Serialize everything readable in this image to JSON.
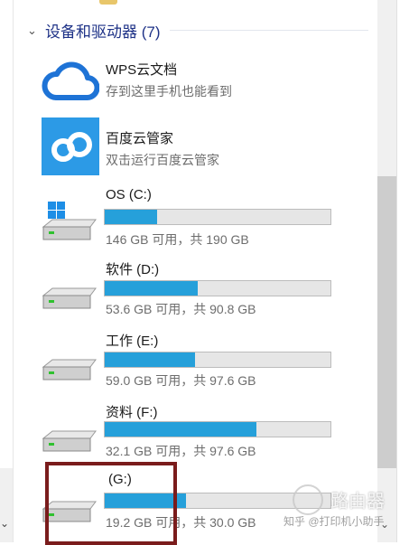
{
  "group": {
    "title": "设备和驱动器 (7)"
  },
  "items": [
    {
      "name": "WPS云文档",
      "sub": "存到这里手机也能看到",
      "icon": "wps-cloud-icon"
    },
    {
      "name": "百度云管家",
      "sub": "双击运行百度云管家",
      "icon": "baidu-cloud-icon"
    }
  ],
  "drives": [
    {
      "name": "OS (C:)",
      "usage": "146 GB 可用，共 190 GB",
      "used_fraction": 0.23
    },
    {
      "name": "软件 (D:)",
      "usage": "53.6 GB 可用，共 90.8 GB",
      "used_fraction": 0.41
    },
    {
      "name": "工作 (E:)",
      "usage": "59.0 GB 可用，共 97.6 GB",
      "used_fraction": 0.4
    },
    {
      "name": "资料 (F:)",
      "usage": "32.1 GB 可用，共 97.6 GB",
      "used_fraction": 0.67
    },
    {
      "name": "(G:)",
      "usage": "19.2 GB 可用，共 30.0 GB",
      "used_fraction": 0.36
    }
  ],
  "watermark": {
    "brand": "路由器",
    "sub": "知乎 @打印机小助手"
  },
  "colors": {
    "header": "#1e3287",
    "bar_fill": "#26a0da",
    "bar_bg": "#e6e6e6",
    "selection": "#7a1c1c"
  }
}
